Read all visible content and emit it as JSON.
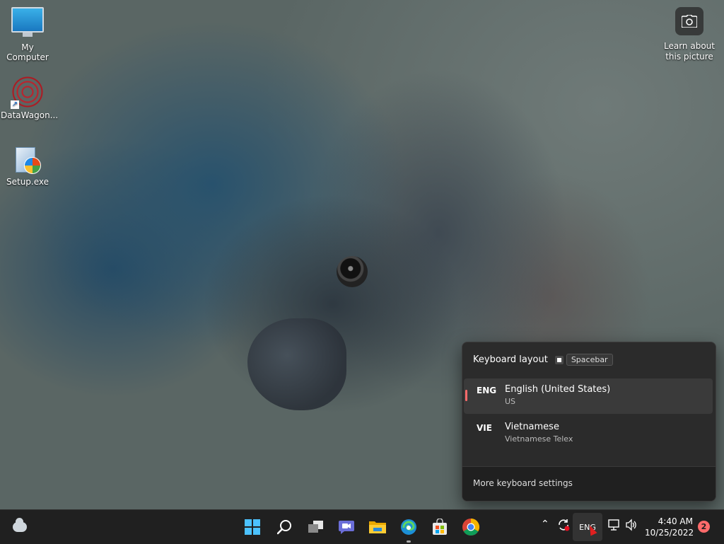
{
  "desktop": {
    "icons": [
      {
        "label": "My Computer"
      },
      {
        "label": "DataWagon..."
      },
      {
        "label": "Setup.exe"
      }
    ],
    "learn_about": "Learn about this picture"
  },
  "keyboard_flyout": {
    "title": "Keyboard layout",
    "shortcut_key": "Spacebar",
    "languages": [
      {
        "code": "ENG",
        "name": "English (United States)",
        "layout": "US",
        "selected": true
      },
      {
        "code": "VIE",
        "name": "Vietnamese",
        "layout": "Vietnamese Telex",
        "selected": false
      }
    ],
    "more_settings": "More keyboard settings",
    "accent_color": "#ff6b6b"
  },
  "taskbar": {
    "pinned": [
      "weather",
      "start",
      "search",
      "task-view",
      "chat",
      "file-explorer",
      "edge",
      "microsoft-store",
      "chrome"
    ],
    "tray": {
      "input_indicator": "ENG",
      "time": "4:40 AM",
      "date": "10/25/2022",
      "notification_count": "2"
    }
  }
}
